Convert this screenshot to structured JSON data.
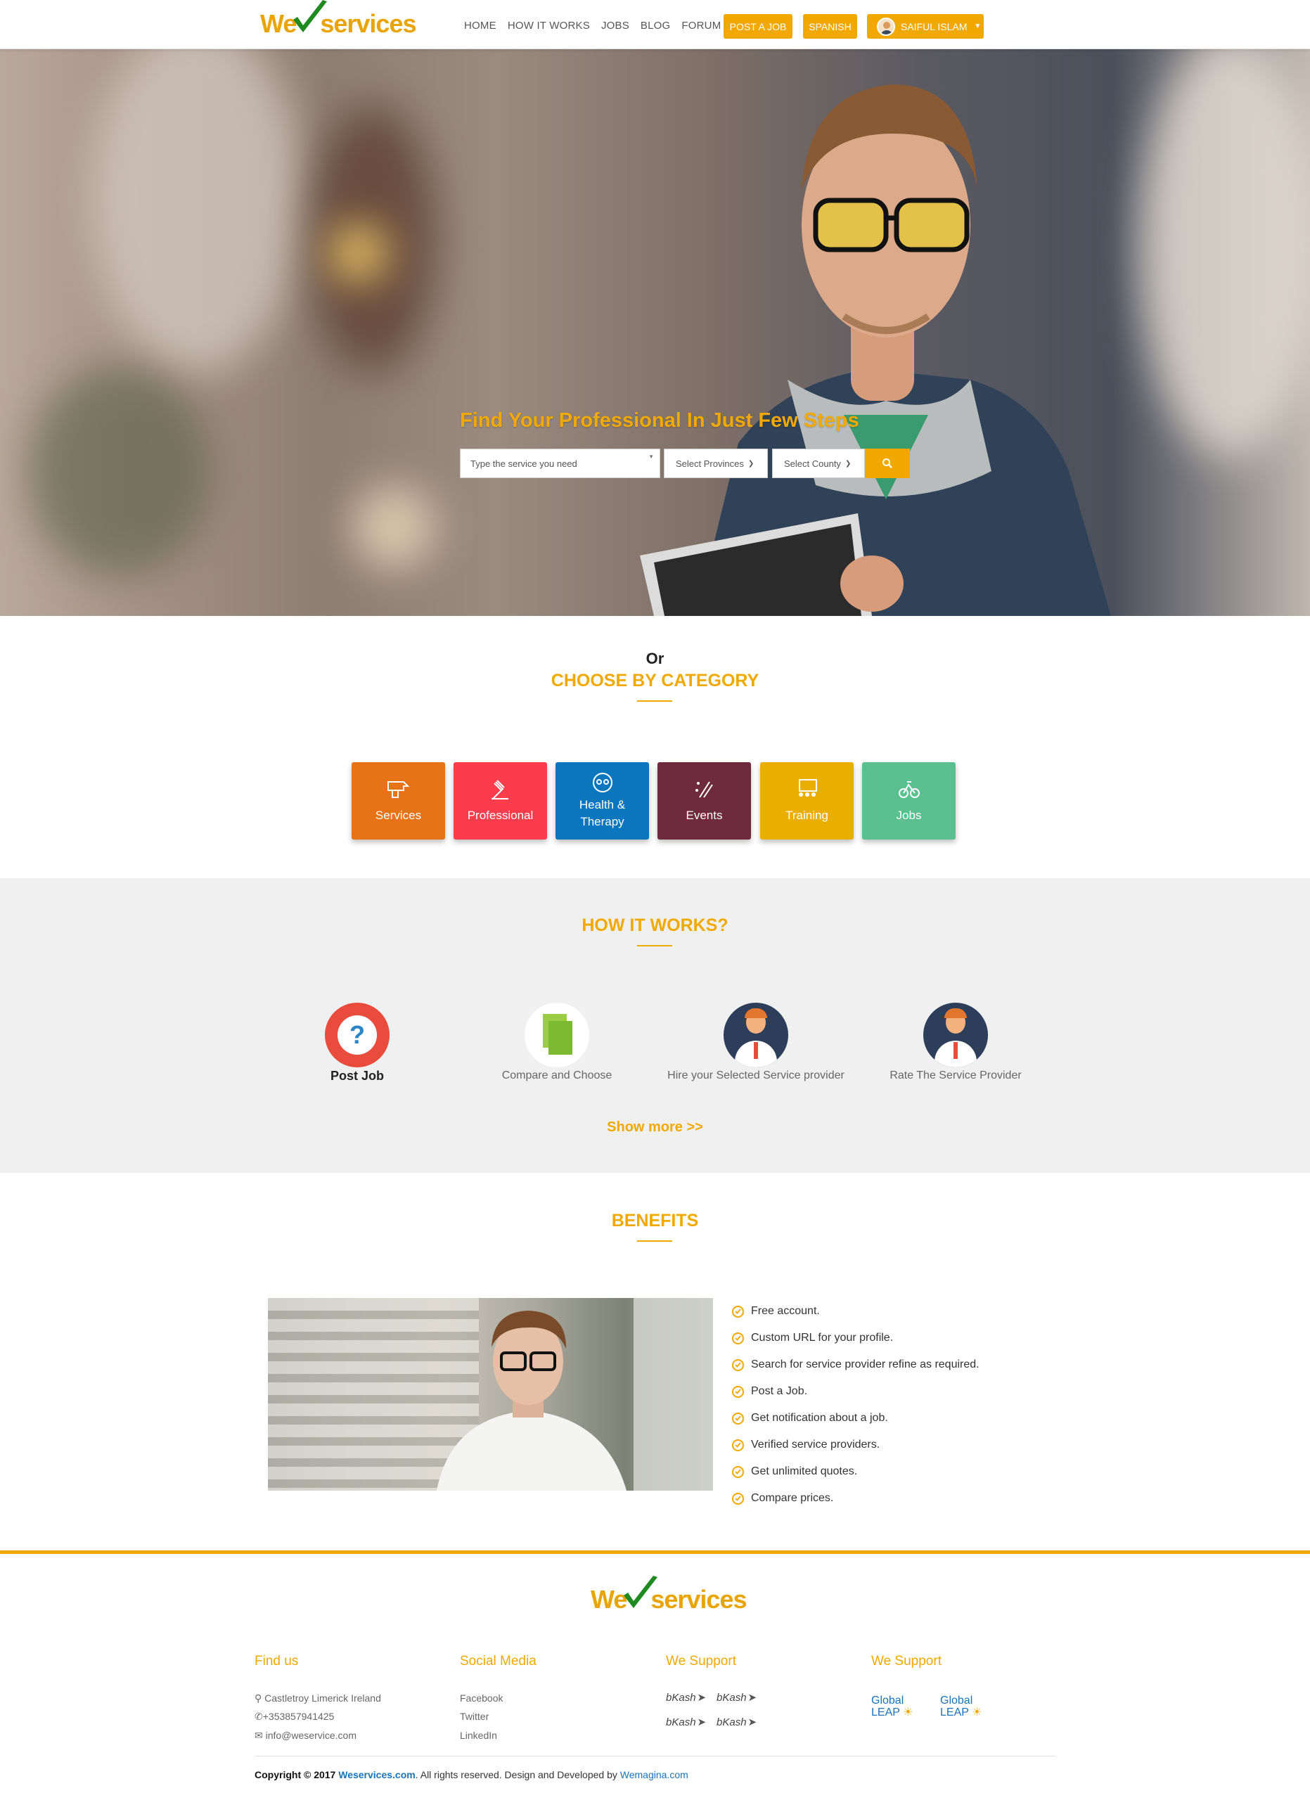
{
  "brand": {
    "part1": "We",
    "part2": "services"
  },
  "nav": {
    "links": [
      "HOME",
      "HOW IT WORKS",
      "JOBS",
      "BLOG",
      "FORUM"
    ],
    "post_job": "POST A JOB",
    "language": "SPANISH",
    "user_name": "SAIFUL ISLAM"
  },
  "hero": {
    "title": "Find Your Professional In Just Few Steps",
    "search_placeholder": "Type the service you need",
    "province_select": "Select Provinces",
    "county_select": "Select County",
    "search_icon": "search-icon"
  },
  "category": {
    "or": "Or",
    "title": "CHOOSE BY CATEGORY",
    "items": [
      {
        "label": "Services",
        "icon": "drill-icon",
        "color": "#e67315"
      },
      {
        "label": "Professional",
        "icon": "gavel-icon",
        "color": "#fb3c4c"
      },
      {
        "label": "Health & Therapy",
        "icon": "therapy-icon",
        "color": "#0a76bd"
      },
      {
        "label": "Events",
        "icon": "party-icon",
        "color": "#6d2b3d"
      },
      {
        "label": "Training",
        "icon": "classroom-icon",
        "color": "#e9ae00"
      },
      {
        "label": "Jobs",
        "icon": "bike-icon",
        "color": "#5ac08f"
      }
    ]
  },
  "how": {
    "title": "HOW IT WORKS?",
    "steps": [
      {
        "label": "Post Job",
        "icon": "question-icon"
      },
      {
        "label": "Compare and Choose",
        "icon": "documents-icon"
      },
      {
        "label": "Hire your Selected Service provider",
        "icon": "person-icon"
      },
      {
        "label": "Rate The Service Provider",
        "icon": "person-icon"
      }
    ],
    "show_more": "Show more >>"
  },
  "benefits": {
    "title": "BENEFITS",
    "items": [
      "Free account.",
      "Custom URL for your profile.",
      "Search for service provider refine as required.",
      "Post a Job.",
      "Get notification about a job.",
      "Verified service providers.",
      "Get unlimited quotes.",
      "Compare prices."
    ]
  },
  "footer": {
    "find_us": {
      "title": "Find us",
      "address": "Castletroy Limerick Ireland",
      "phone": "+353857941425",
      "email": "info@weservice.com"
    },
    "social": {
      "title": "Social Media",
      "links": [
        "Facebook",
        "Twitter",
        "LinkedIn"
      ]
    },
    "support1": {
      "title": "We Support",
      "logos": [
        "bKash",
        "bKash",
        "bKash",
        "bKash"
      ]
    },
    "support2": {
      "title": "We Support",
      "logos": [
        "Global LEAP",
        "Global LEAP"
      ]
    },
    "copyright": {
      "prefix": "Copyright © 2017 ",
      "site": "Weservices.com",
      "middle": ". All rights reserved. Design and Developed by ",
      "dev": "Wemagina.com"
    }
  },
  "colors": {
    "accent": "#f1a800",
    "link": "#1a73b8",
    "section_bg": "#f0f0f0"
  }
}
